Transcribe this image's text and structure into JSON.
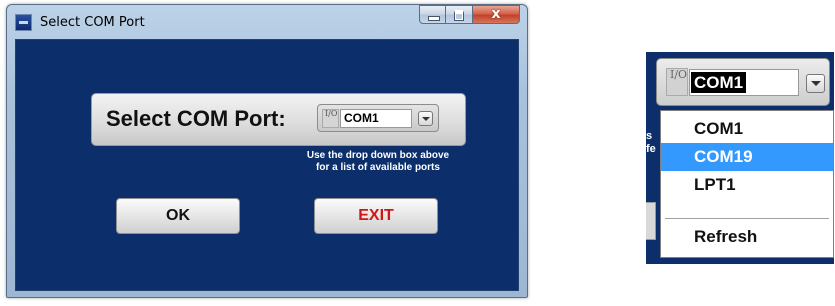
{
  "window": {
    "title": "Select COM Port",
    "close_glyph": "x",
    "select_label": "Select COM Port:",
    "combo_value": "COM1",
    "io_glyph": "I/O",
    "hint_line1": "Use the drop down box above",
    "hint_line2": "for a list of available ports",
    "ok_label": "OK",
    "exit_label": "EXIT"
  },
  "dropdown_zoom": {
    "combo_value": "COM1",
    "io_glyph": "I/O",
    "behind_text": "s\nfe",
    "items": [
      {
        "label": "COM1",
        "selected": false
      },
      {
        "label": "COM19",
        "selected": true
      },
      {
        "label": "LPT1",
        "selected": false
      },
      {
        "label": "Refresh",
        "selected": false
      }
    ]
  },
  "colors": {
    "client_bg": "#0c2f6b",
    "exit_text": "#d01616",
    "selection": "#3399ff"
  },
  "icons": [
    "app-icon",
    "minimize-icon",
    "maximize-icon",
    "close-icon",
    "io-port-icon",
    "chevron-down-icon"
  ]
}
